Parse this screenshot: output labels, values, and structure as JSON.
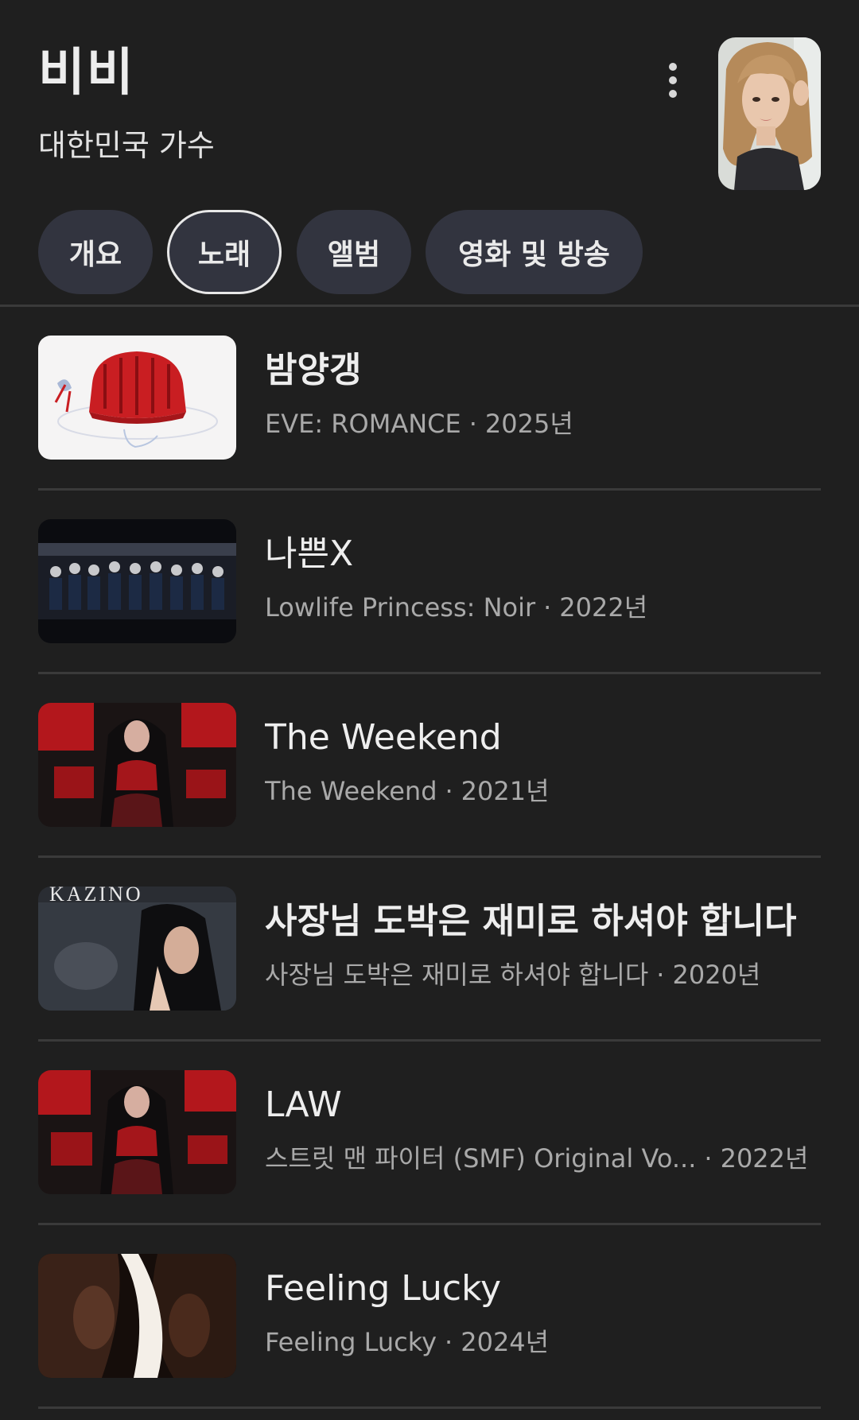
{
  "header": {
    "name": "비비",
    "description": "대한민국 가수",
    "more_icon": "more-vertical-icon"
  },
  "tabs": [
    {
      "label": "개요",
      "selected": false
    },
    {
      "label": "노래",
      "selected": true
    },
    {
      "label": "앨범",
      "selected": false
    },
    {
      "label": "영화 및 방송",
      "selected": false
    }
  ],
  "songs": [
    {
      "title": "밤양갱",
      "album": "EVE: ROMANCE",
      "year": "2025년"
    },
    {
      "title": "나쁜X",
      "album": "Lowlife Princess: Noir",
      "year": "2022년"
    },
    {
      "title": "The Weekend",
      "album": "The Weekend",
      "year": "2021년"
    },
    {
      "title": "사장님 도박은 재미로 하셔야 합니다",
      "album": "사장님 도박은 재미로 하셔야 합니다",
      "year": "2020년"
    },
    {
      "title": "LAW",
      "album": "스트릿 맨 파이터 (SMF) Original Vo...",
      "year": "2022년"
    },
    {
      "title": "Feeling Lucky",
      "album": "Feeling Lucky",
      "year": "2024년"
    }
  ],
  "separator": "·",
  "thumb_text": "KAZINO"
}
